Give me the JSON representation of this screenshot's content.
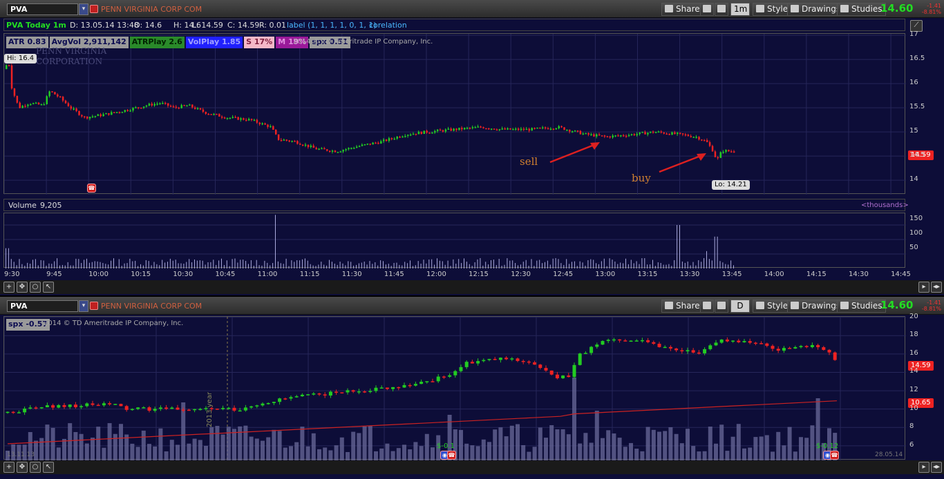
{
  "panel1": {
    "symbol": "PVA",
    "company": "PENN VIRGINIA CORP COM",
    "aggregation": "1m",
    "toolbar": {
      "share": "Share",
      "style": "Style",
      "drawings": "Drawings",
      "studies": "Studies"
    },
    "last": "14.60",
    "change": "-1.41",
    "change_pct": "-8.81%",
    "info": {
      "title": "PVA Today 1m",
      "date": "D: 13.05.14 13:48",
      "open": "O: 14.6",
      "high": "H: 14.6",
      "low": "L: 14.59",
      "close": "C: 14.59",
      "range": "R: 0.01",
      "label": "label (1, 1, 1, 1, 0, 1, 1)",
      "study": "corelation"
    },
    "studies": [
      {
        "text": "ATR 0.83",
        "bg": "#9a9a9a",
        "fg": "#0a0a50"
      },
      {
        "text": "AvgVol 2,911,142",
        "bg": "#9a9a9a",
        "fg": "#0a0a50"
      },
      {
        "text": "ATRPlay 2.6",
        "bg": "#2a8a2a",
        "fg": "#002200"
      },
      {
        "text": "VolPlay 1.85",
        "bg": "#2020ff",
        "fg": "#a0a0ff"
      },
      {
        "text": "S 17%",
        "bg": "#f4b8c8",
        "fg": "#802040"
      },
      {
        "text": "M 19%",
        "bg": "#9a1a9a",
        "fg": "#e090e0"
      },
      {
        "text": "spx 0.51",
        "bg": "#9a9a9a",
        "fg": "#0a0a50"
      }
    ],
    "copyright": "2014 © TD Ameritrade IP Company, Inc.",
    "watermark": [
      "PENN VIRGINIA",
      "CORPORATION"
    ],
    "hi_label": "Hi: 16.4",
    "lo_label": "Lo: 14.21",
    "price_tag": "14.59",
    "annotations": {
      "sell": "sell",
      "buy": "buy"
    },
    "volume_label": "Volume",
    "volume_value": "9,205",
    "thousands": "<thousands>",
    "price_ticks": [
      "17",
      "16.5",
      "16",
      "15.5",
      "15",
      "14.5",
      "14"
    ],
    "volume_ticks": [
      "150",
      "100",
      "50"
    ],
    "time_ticks": [
      "9:30",
      "9:45",
      "10:00",
      "10:15",
      "10:30",
      "10:45",
      "11:00",
      "11:15",
      "11:30",
      "11:45",
      "12:00",
      "12:15",
      "12:30",
      "12:45",
      "13:00",
      "13:15",
      "13:30",
      "13:45",
      "14:00",
      "14:15",
      "14:30",
      "14:45"
    ]
  },
  "panel2": {
    "symbol": "PVA",
    "company": "PENN VIRGINIA CORP COM",
    "aggregation": "D",
    "toolbar": {
      "share": "Share",
      "style": "Style",
      "drawings": "Drawings",
      "studies": "Studies"
    },
    "last": "14.60",
    "change": "-1.41",
    "change_pct": "-8.81%",
    "spx": "spx -0.57",
    "copyright": "2014 © TD Ameritrade IP Company, Inc.",
    "price_ticks": [
      "20",
      "18",
      "16",
      "14",
      "12",
      "10",
      "8",
      "6"
    ],
    "price_tag": "14.59",
    "ma_tag": "10.65",
    "date_start": "13.11.13",
    "date_end": "28.05.14",
    "year_label": "2013 year",
    "div1": "$-0.1",
    "div2": "$-0.12"
  },
  "colors": {
    "up": "#22cc22",
    "down": "#ee2222",
    "bg": "#0d0d38",
    "grid": "#26265a",
    "volume": "#6a6a9a",
    "ma": "#cc2222",
    "accent_green": "#22dd22"
  }
}
